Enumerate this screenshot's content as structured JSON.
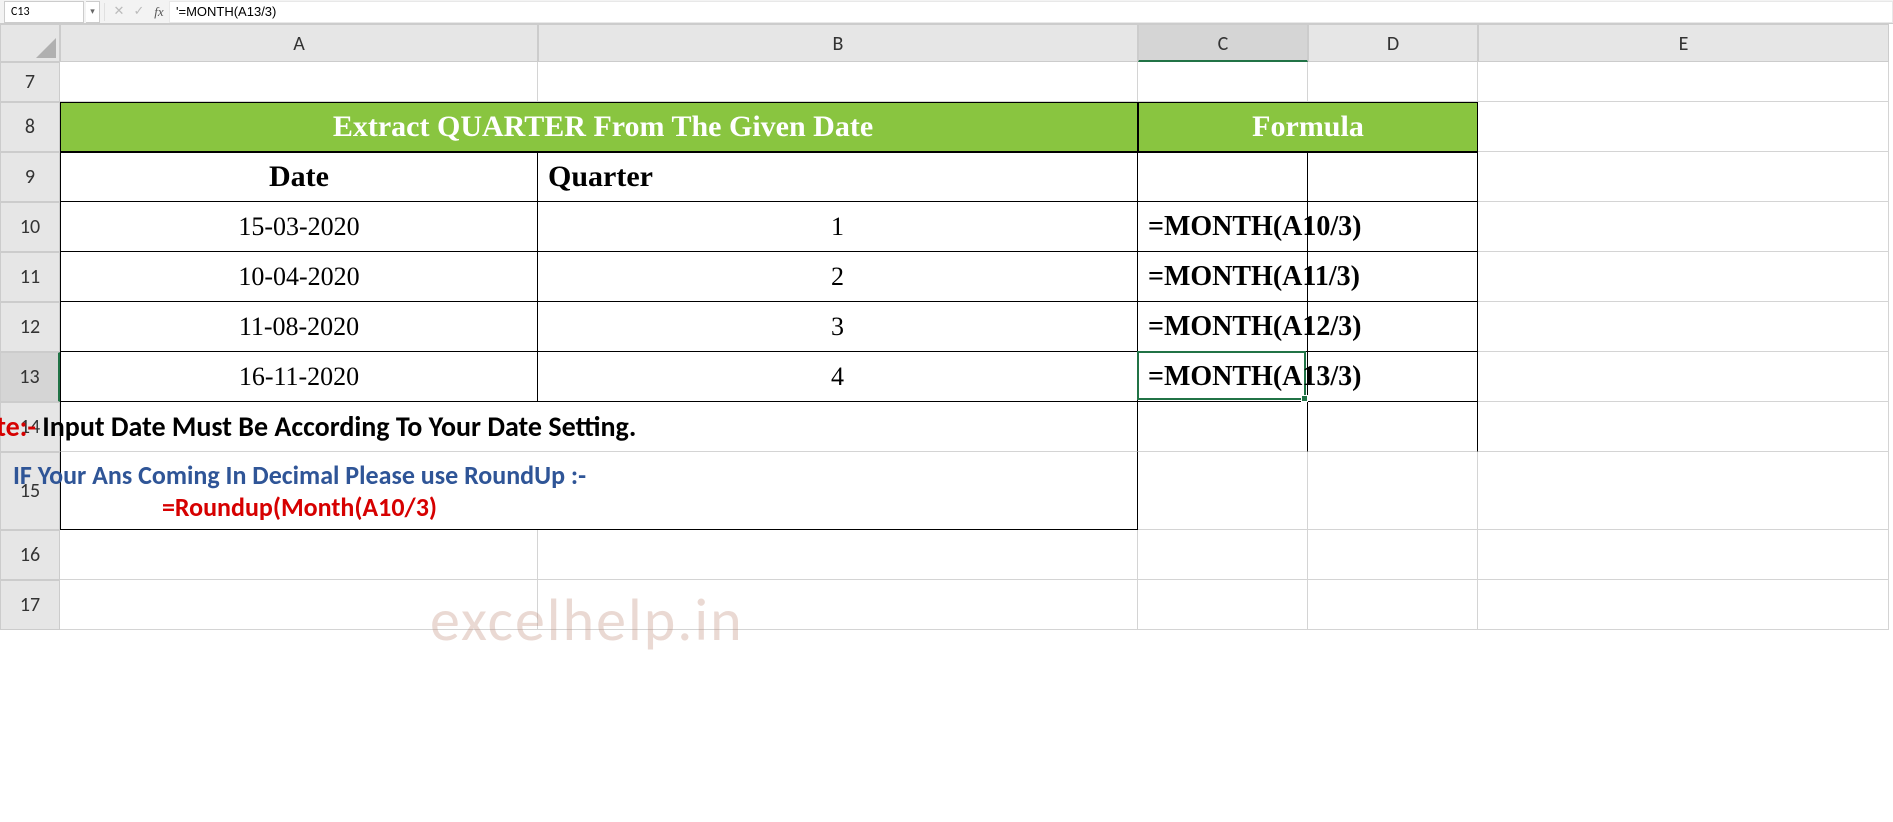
{
  "formula_bar": {
    "name_box": "C13",
    "formula": "'=MONTH(A13/3)"
  },
  "cols": [
    "A",
    "B",
    "C",
    "D",
    "E"
  ],
  "rows": [
    "7",
    "8",
    "9",
    "10",
    "11",
    "12",
    "13",
    "14",
    "15",
    "16",
    "17"
  ],
  "active_cell": "C13",
  "header": {
    "main": "Extract QUARTER From The Given Date",
    "formula_col": "Formula"
  },
  "table": {
    "headers": {
      "date": "Date",
      "quarter": "Quarter"
    },
    "rows": [
      {
        "date": "15-03-2020",
        "quarter": "1",
        "formula": "=MONTH(A10/3)"
      },
      {
        "date": "10-04-2020",
        "quarter": "2",
        "formula": "=MONTH(A11/3)"
      },
      {
        "date": "11-08-2020",
        "quarter": "3",
        "formula": "=MONTH(A12/3)"
      },
      {
        "date": "16-11-2020",
        "quarter": "4",
        "formula": "=MONTH(A13/3)"
      }
    ]
  },
  "notes": {
    "line1_prefix": "Note:- ",
    "line1_text": "Input Date Must Be According To Your Date Setting.",
    "line2": "IF Your Ans Coming In Decimal Please use RoundUp :-",
    "line3": "=Roundup(Month(A10/3)"
  },
  "watermark": "excelhelp.in"
}
